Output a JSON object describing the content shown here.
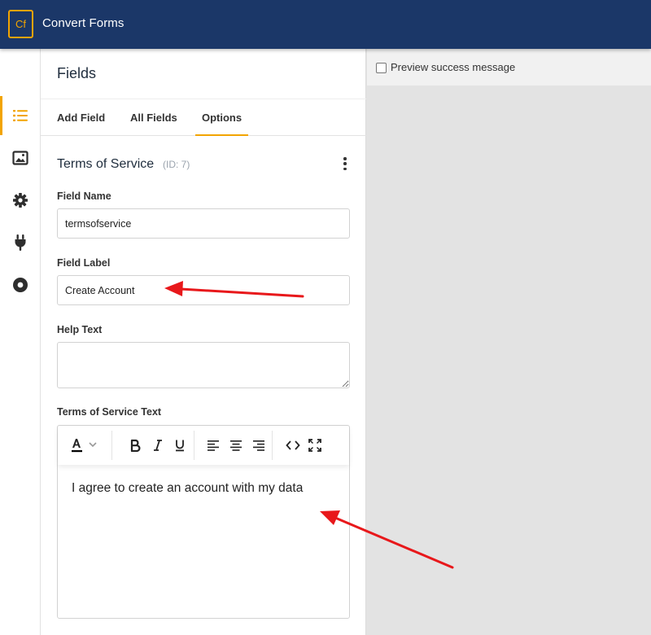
{
  "app": {
    "logo": "Cf",
    "title": "Convert Forms"
  },
  "icon_sidebar": {
    "items": [
      {
        "icon": "list-icon",
        "active": true
      },
      {
        "icon": "image-icon",
        "active": false
      },
      {
        "icon": "gear-icon",
        "active": false
      },
      {
        "icon": "plug-icon",
        "active": false
      },
      {
        "icon": "record-icon",
        "active": false
      }
    ]
  },
  "panel": {
    "title": "Fields",
    "tabs": [
      {
        "label": "Add Field",
        "active": false
      },
      {
        "label": "All Fields",
        "active": false
      },
      {
        "label": "Options",
        "active": true
      }
    ],
    "section": {
      "title": "Terms of Service",
      "id": "(ID: 7)"
    },
    "fields": {
      "field_name": {
        "label": "Field Name",
        "value": "termsofservice"
      },
      "field_label": {
        "label": "Field Label",
        "value": "Create Account"
      },
      "help_text": {
        "label": "Help Text",
        "value": ""
      },
      "tos_text": {
        "label": "Terms of Service Text",
        "value": "I agree to create an account with my data"
      }
    }
  },
  "preview": {
    "checkbox_label": "Preview success message",
    "checked": false
  },
  "colors": {
    "header": "#1b3768",
    "accent": "#f2a400",
    "annotation": "#e8181b"
  }
}
